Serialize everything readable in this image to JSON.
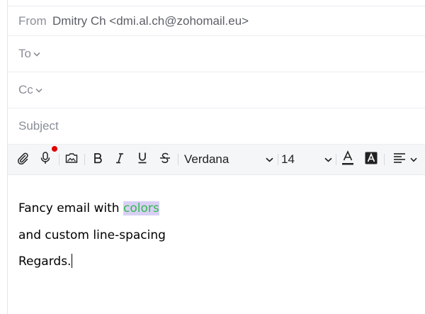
{
  "compose": {
    "from_label": "From",
    "from_value": "Dmitry Ch <dmi.al.ch@zohomail.eu>",
    "to_label": "To",
    "cc_label": "Cc",
    "subject_placeholder": "Subject"
  },
  "toolbar": {
    "icons": [
      "paperclip-icon",
      "microphone-icon",
      "insert-image-icon",
      "bold-icon",
      "italic-icon",
      "underline-icon",
      "strikethrough-icon",
      "font-color-icon",
      "background-color-icon",
      "align-icon"
    ],
    "font_family": "Verdana",
    "font_size": "14",
    "recording_dot_color": "#e00000"
  },
  "body": {
    "line1_prefix": "Fancy email with ",
    "line1_highlight": "colors",
    "line2": "and custom line-spacing",
    "line3": "Regards.",
    "highlight_text_color": "#32b84f",
    "highlight_bg_color": "#d8d0f4"
  }
}
